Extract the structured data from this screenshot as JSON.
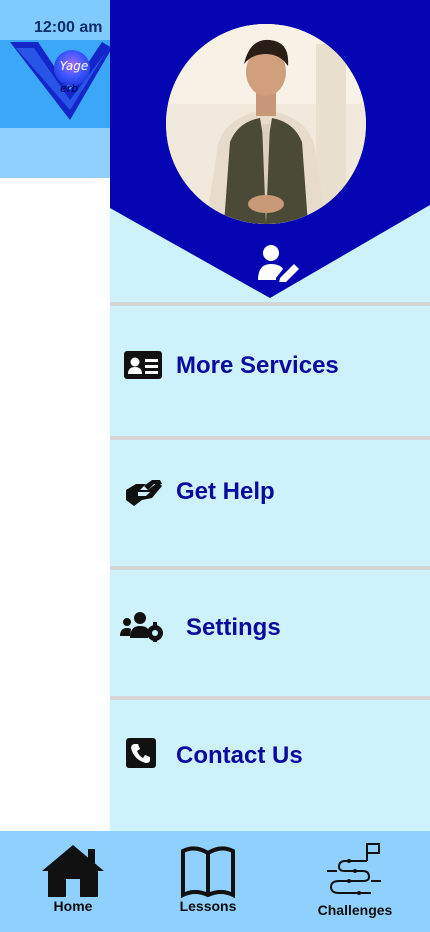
{
  "status_bar": {
    "time": "12:00 am"
  },
  "logo": {
    "line1": "Yage",
    "line2": "erb"
  },
  "drawer": {
    "profile_photo": "profile-photo",
    "edit_profile_icon": "edit-user-icon",
    "items": [
      {
        "label": "More Services",
        "icon": "id-card-icon"
      },
      {
        "label": "Get Help",
        "icon": "handshake-icon"
      },
      {
        "label": "Settings",
        "icon": "users-gear-icon"
      },
      {
        "label": "Contact Us",
        "icon": "phone-icon"
      }
    ]
  },
  "bottom_nav": {
    "items": [
      {
        "label": "Home",
        "icon": "home-icon"
      },
      {
        "label": "Lessons",
        "icon": "book-icon"
      },
      {
        "label": "Challenges",
        "icon": "route-flag-icon"
      }
    ]
  },
  "colors": {
    "drawer_header": "#0505b4",
    "drawer_bg": "#cdf2fc",
    "menu_text": "#0a0a9e",
    "bottom_nav_bg": "#8fd0ff"
  }
}
